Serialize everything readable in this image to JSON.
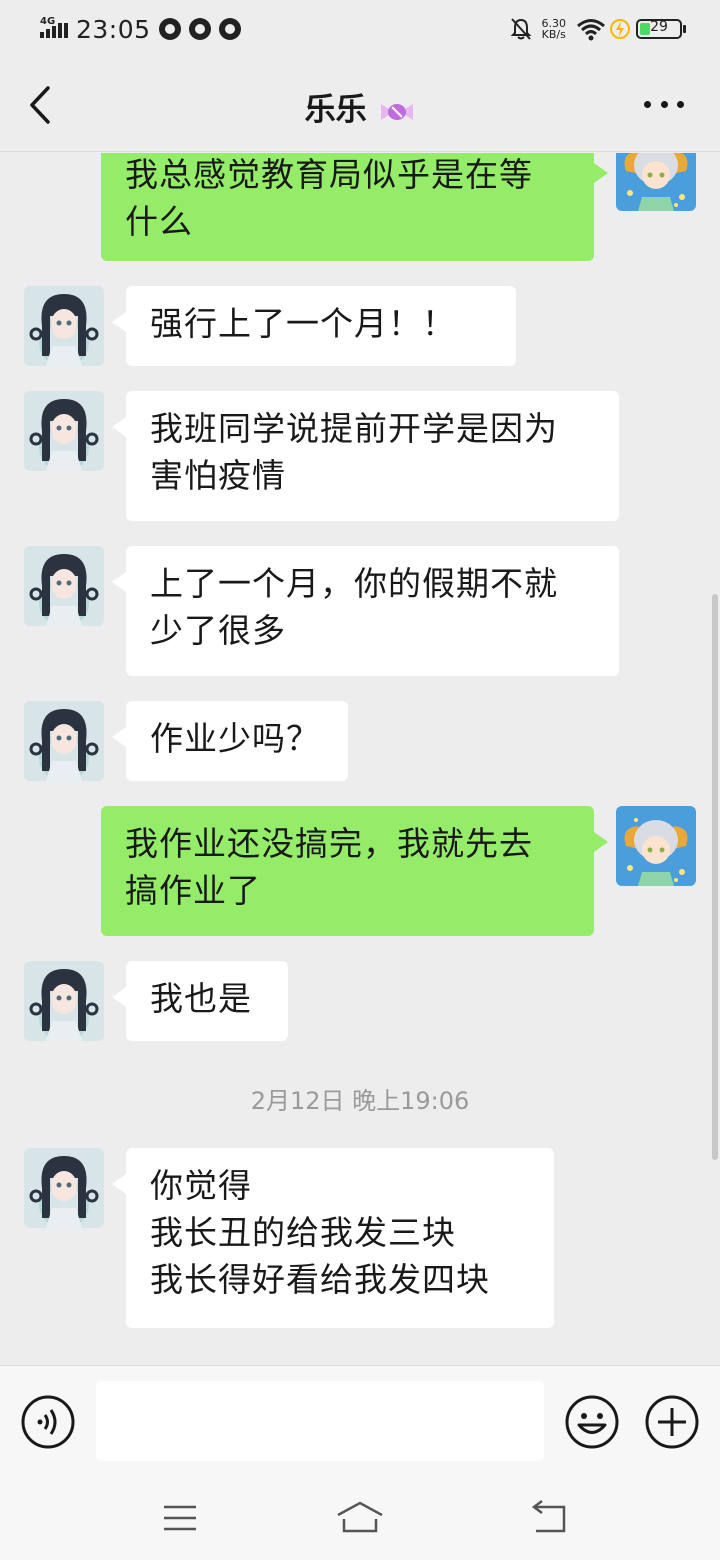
{
  "status_bar": {
    "network": "4G",
    "time": "23:05",
    "speed_value": "6.30",
    "speed_unit": "KB/s",
    "battery": "29",
    "battery_color": "#4cd964"
  },
  "header": {
    "title": "乐乐",
    "back_icon": "chevron-left-icon",
    "more_icon": "more-dots-icon"
  },
  "messages": [
    {
      "side": "out",
      "text": "我总感觉教育局似乎是在等\n什么"
    },
    {
      "side": "in",
      "text": "强行上了一个月！！"
    },
    {
      "side": "in",
      "text": "我班同学说提前开学是因为\n害怕疫情"
    },
    {
      "side": "in",
      "text": "上了一个月，你的假期不就\n少了很多"
    },
    {
      "side": "in",
      "text": "作业少吗？"
    },
    {
      "side": "out",
      "text": "我作业还没搞完，我就先去\n搞作业了"
    },
    {
      "side": "in",
      "text": "我也是"
    },
    {
      "side": "in",
      "text": "你觉得\n我长丑的给我发三块\n我长得好看给我发四块"
    }
  ],
  "timestamp": "2月12日 晚上19:06",
  "input_bar": {
    "voice_icon": "voice-icon",
    "emoji_icon": "emoji-icon",
    "plus_icon": "plus-icon",
    "input_value": ""
  },
  "nav_bar": {
    "items": [
      "menu-icon",
      "home-icon",
      "back-icon"
    ]
  },
  "colors": {
    "background": "#ededed",
    "bubble_in": "#ffffff",
    "bubble_out": "#95ec69",
    "timestamp": "#9a9a9a"
  }
}
